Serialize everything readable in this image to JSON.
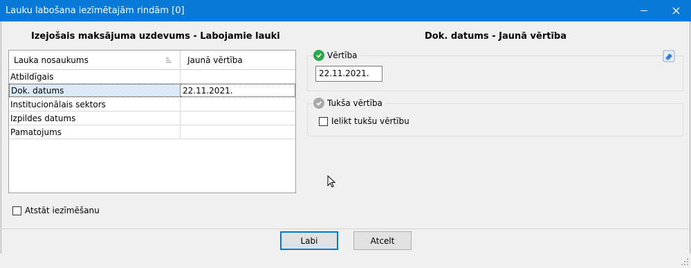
{
  "window": {
    "title": "Lauku labošana iezīmētajām rindām [0]"
  },
  "left_panel": {
    "title": "Izejošais maksājuma uzdevums - Labojamie lauki",
    "columns": [
      "Lauka nosaukums",
      "Jaunā vērtība"
    ],
    "rows": [
      {
        "name": "Atbildīgais",
        "value": ""
      },
      {
        "name": "Dok. datums",
        "value": "22.11.2021.",
        "selected": true
      },
      {
        "name": "Institucionālais sektors",
        "value": ""
      },
      {
        "name": "Izpildes datums",
        "value": ""
      },
      {
        "name": "Pamatojums",
        "value": ""
      }
    ],
    "keep_selection_label": "Atstāt iezīmēšanu"
  },
  "right_panel": {
    "title": "Dok. datums - Jaunā vērtība",
    "value_group_label": "Vērtība",
    "value": "22.11.2021.",
    "empty_group_label": "Tukša vērtība",
    "empty_checkbox_label": "Ielikt tukšu vērtību"
  },
  "buttons": {
    "ok": "Labi",
    "cancel": "Atcelt"
  },
  "icons": {
    "close": "close-icon",
    "minimize": "minimize-icon",
    "value_status": "green-check-icon",
    "empty_status": "gray-check-icon",
    "clear": "eraser-icon",
    "sort": "sort-icon"
  },
  "colors": {
    "titlebar": "#0a78d7",
    "selection": "#dce9f7",
    "accent_green": "#2ba84a"
  }
}
